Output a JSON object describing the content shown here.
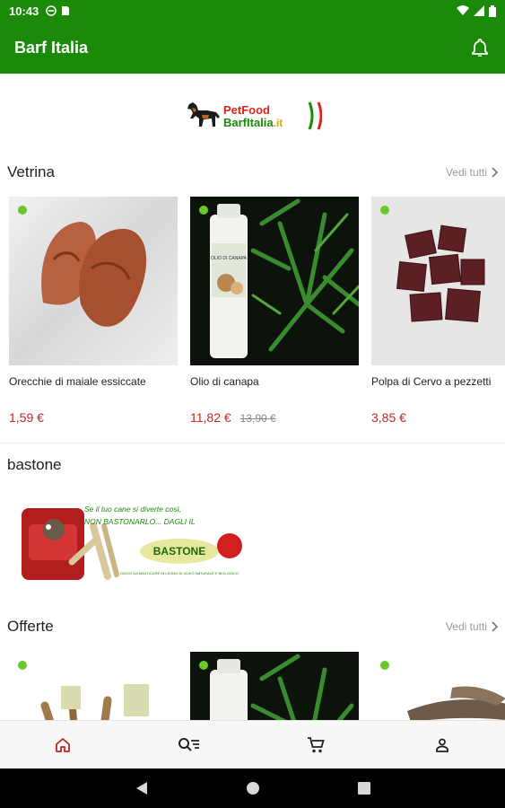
{
  "status_bar": {
    "time": "10:43"
  },
  "app_bar": {
    "title": "Barf Italia"
  },
  "logo": {
    "line1": "PetFood",
    "line2": "BarfItalia",
    "suffix": ".it"
  },
  "sections": {
    "vetrina": {
      "title": "Vetrina",
      "see_all": "Vedi tutti",
      "products": [
        {
          "name": "Orecchie di maiale essiccate",
          "price": "1,59 €",
          "old_price": ""
        },
        {
          "name": "Olio di canapa",
          "price": "11,82 €",
          "old_price": "13,90 €"
        },
        {
          "name": "Polpa di Cervo a pezzetti",
          "price": "3,85 €",
          "old_price": ""
        }
      ]
    },
    "bastone": {
      "title": "bastone",
      "banner_line1": "Se il tuo cane si diverte così,",
      "banner_line2": "NON BASTONARLO... DAGLI IL",
      "banner_brand": "BASTONE",
      "banner_small": "GIOCO DA MASTICARE IN LEGNO DI ULIVO NATURALE E BIOLOGICO"
    },
    "offerte": {
      "title": "Offerte",
      "see_all": "Vedi tutti"
    }
  },
  "product_label": {
    "olio": "OLIO DI CANAPA"
  },
  "bottom_nav": [
    "home-icon",
    "search-filter-icon",
    "cart-icon",
    "profile-icon"
  ],
  "colors": {
    "primary": "#1a8a08",
    "price": "#c0291f",
    "badge": "#6ac82a",
    "active_nav": "#c0291f"
  }
}
